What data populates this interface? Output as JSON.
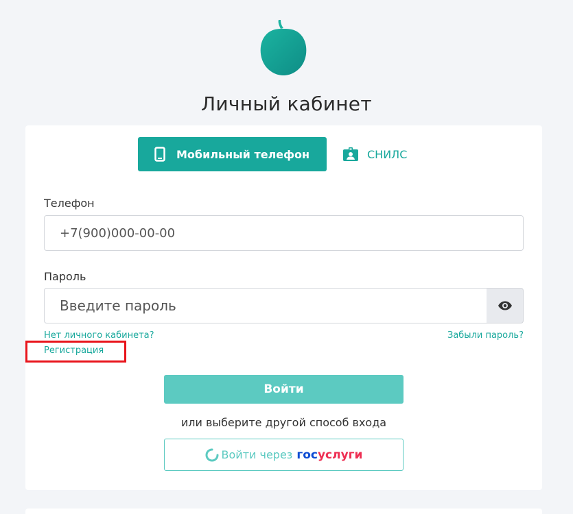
{
  "header": {
    "title": "Личный кабинет"
  },
  "tabs": [
    {
      "label": "Мобильный телефон",
      "icon": "mobile-phone-icon",
      "active": true
    },
    {
      "label": "СНИЛС",
      "icon": "id-badge-icon",
      "active": false
    }
  ],
  "form": {
    "phone_label": "Телефон",
    "phone_placeholder": "+7(900)000-00-00",
    "password_label": "Пароль",
    "password_placeholder": "Введите пароль",
    "password_toggle_icon": "eye-icon",
    "no_account_text": "Нет личного кабинета?",
    "register_link": "Регистрация",
    "forgot_link": "Забыли пароль?",
    "login_button": "Войти",
    "alt_text": "или выберите другой способ входа",
    "gosuslugi_prefix": "Войти через",
    "gosuslugi_brand_part1": "гос",
    "gosuslugi_brand_part2": "услуги"
  },
  "colors": {
    "accent": "#18a89c",
    "accent_light": "#5ccac1",
    "highlight_border": "#e8141b",
    "gosuslugi_blue": "#0d4cd3",
    "gosuslugi_red": "#ee2f53"
  }
}
